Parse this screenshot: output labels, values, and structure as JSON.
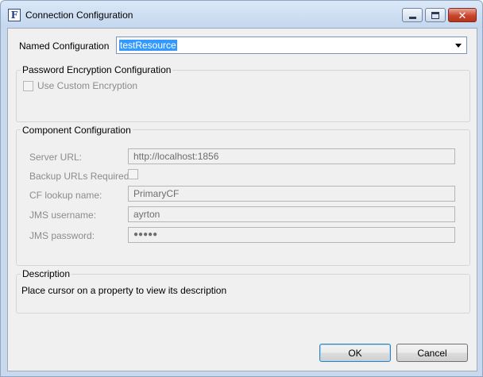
{
  "window": {
    "title": "Connection Configuration",
    "app_icon_letter": "F",
    "icon": "app-icon"
  },
  "named": {
    "label": "Named Configuration",
    "value": "testResource"
  },
  "password_group": {
    "title": "Password Encryption Configuration",
    "checkbox_label": "Use Custom Encryption",
    "checked": false
  },
  "component_group": {
    "title": "Component Configuration",
    "fields": [
      {
        "label": "Server URL:",
        "value": "http://localhost:1856"
      },
      {
        "label": "Backup URLs Required",
        "checked": false
      },
      {
        "label": "CF lookup name:",
        "value": "PrimaryCF"
      },
      {
        "label": "JMS username:",
        "value": "ayrton"
      },
      {
        "label": "JMS password:",
        "value": "●●●●●"
      }
    ]
  },
  "description_group": {
    "title": "Description",
    "text": "Place cursor on a property to view its description"
  },
  "buttons": {
    "ok": "OK",
    "cancel": "Cancel"
  },
  "colors": {
    "selection": "#3399ff",
    "close_button": "#c8452d",
    "disabled_text": "#8c8c8c"
  }
}
